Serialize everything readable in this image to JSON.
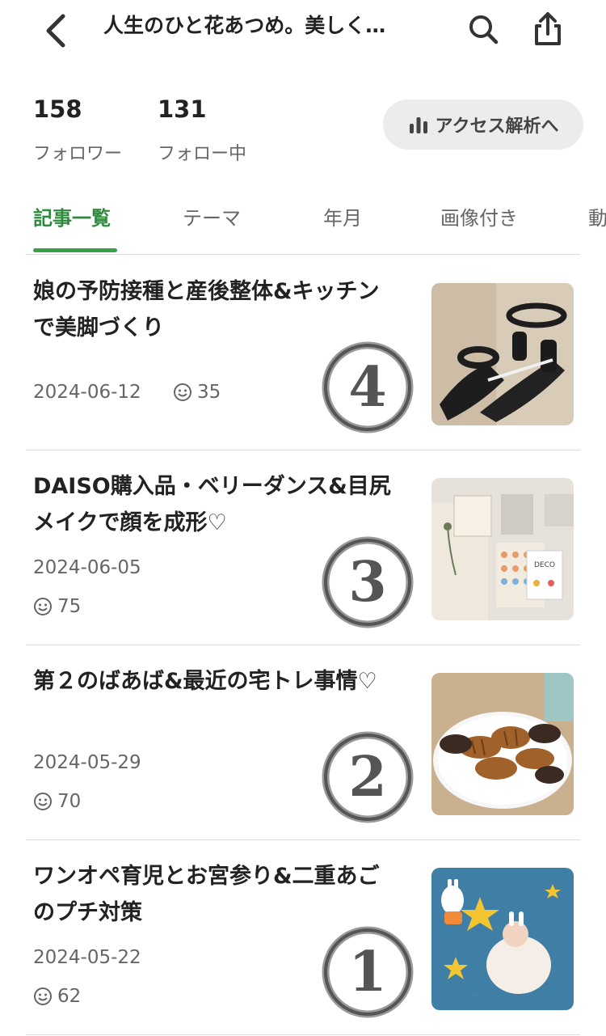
{
  "header": {
    "title": "人生のひと花あつめ。美しく…",
    "back_icon": "chevron-left-icon",
    "search_icon": "search-icon",
    "share_icon": "share-icon"
  },
  "stats": {
    "followers_count": "158",
    "followers_label": "フォロワー",
    "following_count": "131",
    "following_label": "フォロー中",
    "access_label": "アクセス解析へ",
    "access_icon": "bar-chart-icon"
  },
  "tabs": [
    {
      "label": "記事一覧",
      "active": true
    },
    {
      "label": "テーマ",
      "active": false
    },
    {
      "label": "年月",
      "active": false
    },
    {
      "label": "画像付き",
      "active": false
    },
    {
      "label": "動",
      "active": false
    }
  ],
  "accent_color": "#3aa14a",
  "articles": [
    {
      "title": "娘の予防接種と産後整体&キッチンで美脚づくり",
      "date": "2024-06-12",
      "likes": "35",
      "marker": "④",
      "thumb": "sandals-photo"
    },
    {
      "title": "DAISO購入品・ベリーダンス&目尻メイクで顔を成形♡",
      "date": "2024-06-05",
      "likes": "75",
      "marker": "③",
      "thumb": "daiso-items-photo"
    },
    {
      "title": "第２のばあば&最近の宅トレ事情♡",
      "date": "2024-05-29",
      "likes": "70",
      "marker": "②",
      "thumb": "croissants-photo"
    },
    {
      "title": "ワンオペ育児とお宮参り&二重あごのプチ対策",
      "date": "2024-05-22",
      "likes": "62",
      "marker": "①",
      "thumb": "baby-moon-photo"
    }
  ]
}
